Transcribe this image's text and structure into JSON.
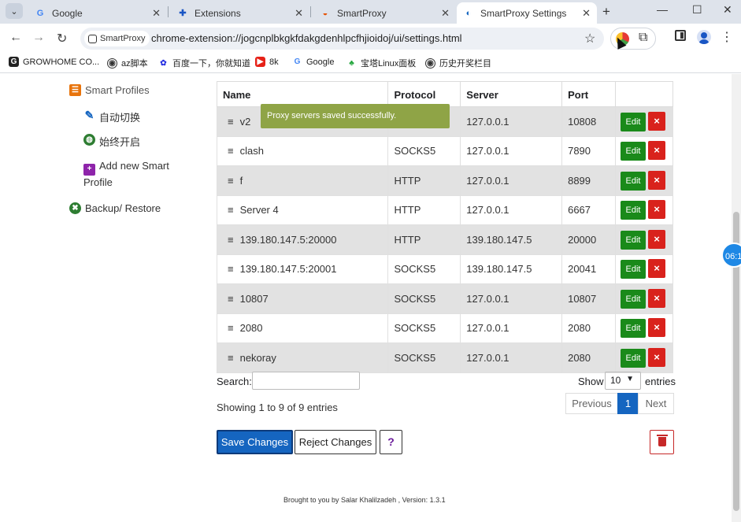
{
  "browser": {
    "tabs": [
      {
        "title": "Google",
        "icon": "google-icon"
      },
      {
        "title": "Extensions",
        "icon": "puzzle-icon"
      },
      {
        "title": "SmartProxy",
        "icon": "smartproxy-icon"
      },
      {
        "title": "SmartProxy Settings",
        "icon": "smartproxy-icon",
        "active": true
      }
    ],
    "site_chip": "SmartProxy",
    "url": "chrome-extension://jogcnplbkgkfdakgdenhlpcfhjioidoj/ui/settings.html",
    "bookmarks": [
      {
        "label": "GROWHOME CO...",
        "icon": "growhome-icon"
      },
      {
        "label": "az脚本",
        "icon": "az-icon"
      },
      {
        "label": "百度一下，你就知道",
        "icon": "baidu-icon"
      },
      {
        "label": "8k",
        "icon": "youtube-icon"
      },
      {
        "label": "Google",
        "icon": "google-icon"
      },
      {
        "label": "宝塔Linux面板",
        "icon": "bt-icon"
      },
      {
        "label": "历史开奖栏目",
        "icon": "history-icon"
      }
    ]
  },
  "sidebar": {
    "items": [
      {
        "label": "Smart Profiles",
        "icon": "list-icon"
      },
      {
        "label": "自动切换",
        "icon": "magic-wand-icon"
      },
      {
        "label": "始终开启",
        "icon": "globe-icon"
      },
      {
        "label": "Add new Smart Profile",
        "icon": "plus-square-icon"
      },
      {
        "label": "Backup/ Restore",
        "icon": "backup-icon"
      }
    ]
  },
  "toast": "Proxy servers saved successfully.",
  "table": {
    "headers": [
      "Name",
      "Protocol",
      "Server",
      "Port"
    ],
    "rows": [
      {
        "name": "v2",
        "protocol": "",
        "server": "127.0.0.1",
        "port": "10808"
      },
      {
        "name": "clash",
        "protocol": "SOCKS5",
        "server": "127.0.0.1",
        "port": "7890"
      },
      {
        "name": "f",
        "protocol": "HTTP",
        "server": "127.0.0.1",
        "port": "8899"
      },
      {
        "name": "Server 4",
        "protocol": "HTTP",
        "server": "127.0.0.1",
        "port": "6667"
      },
      {
        "name": "139.180.147.5:20000",
        "protocol": "HTTP",
        "server": "139.180.147.5",
        "port": "20000"
      },
      {
        "name": "139.180.147.5:20001",
        "protocol": "SOCKS5",
        "server": "139.180.147.5",
        "port": "20041"
      },
      {
        "name": "10807",
        "protocol": "SOCKS5",
        "server": "127.0.0.1",
        "port": "10807"
      },
      {
        "name": "2080",
        "protocol": "SOCKS5",
        "server": "127.0.0.1",
        "port": "2080"
      },
      {
        "name": "nekoray",
        "protocol": "SOCKS5",
        "server": "127.0.0.1",
        "port": "2080"
      }
    ],
    "edit_label": "Edit",
    "delete_label": "×"
  },
  "controls": {
    "search_label": "Search:",
    "search_value": "",
    "show_label": "Show",
    "page_length": "10",
    "entries_label": "entries",
    "info": "Showing 1 to 9 of 9 entries",
    "pagination": {
      "previous": "Previous",
      "current": "1",
      "next": "Next"
    }
  },
  "actions": {
    "save": "Save Changes",
    "reject": "Reject Changes",
    "help": "?"
  },
  "footer": "Brought to you by Salar Khalilzadeh , Version: 1.3.1",
  "overlay_timer": "06:1",
  "colors": {
    "primary": "#1565c0",
    "edit": "#1a8a1a",
    "delete": "#d9221c",
    "toast": "#8fa446"
  }
}
